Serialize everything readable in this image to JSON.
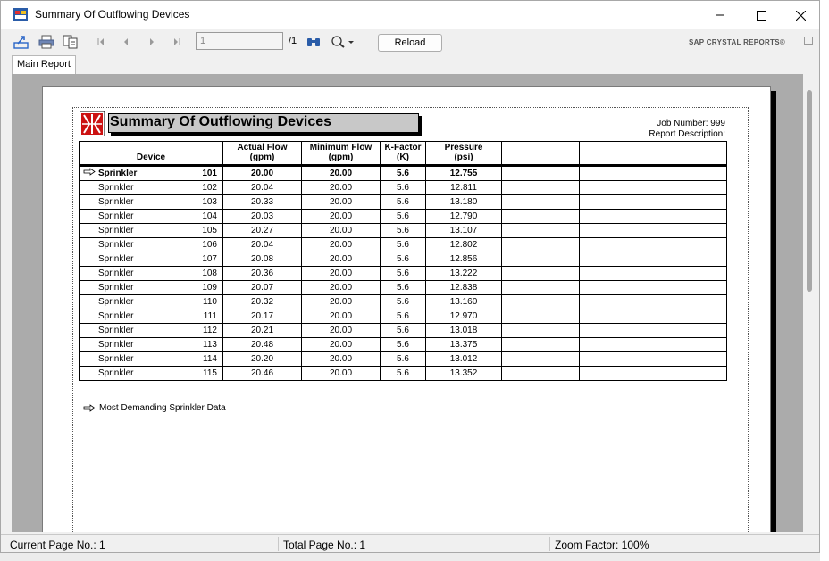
{
  "window": {
    "title": "Summary Of Outflowing Devices"
  },
  "toolbar": {
    "page_value": "1",
    "page_total": "/1",
    "reload_label": "Reload",
    "brand": "SAP CRYSTAL REPORTS®"
  },
  "tabs": [
    {
      "label": "Main Report"
    }
  ],
  "report": {
    "title": "Summary Of Outflowing Devices",
    "job_number": "Job Number: 999",
    "description": "Report Description:",
    "headers": {
      "device": "Device",
      "actual_flow": "Actual Flow",
      "actual_flow_unit": "(gpm)",
      "min_flow": "Minimum Flow",
      "min_flow_unit": "(gpm)",
      "kfactor": "K-Factor",
      "kfactor_unit": "(K)",
      "pressure": "Pressure",
      "pressure_unit": "(psi)"
    },
    "rows": [
      {
        "name": "Sprinkler",
        "num": "101",
        "actual": "20.00",
        "min": "20.00",
        "k": "5.6",
        "p": "12.755",
        "bold": true
      },
      {
        "name": "Sprinkler",
        "num": "102",
        "actual": "20.04",
        "min": "20.00",
        "k": "5.6",
        "p": "12.811"
      },
      {
        "name": "Sprinkler",
        "num": "103",
        "actual": "20.33",
        "min": "20.00",
        "k": "5.6",
        "p": "13.180"
      },
      {
        "name": "Sprinkler",
        "num": "104",
        "actual": "20.03",
        "min": "20.00",
        "k": "5.6",
        "p": "12.790"
      },
      {
        "name": "Sprinkler",
        "num": "105",
        "actual": "20.27",
        "min": "20.00",
        "k": "5.6",
        "p": "13.107"
      },
      {
        "name": "Sprinkler",
        "num": "106",
        "actual": "20.04",
        "min": "20.00",
        "k": "5.6",
        "p": "12.802"
      },
      {
        "name": "Sprinkler",
        "num": "107",
        "actual": "20.08",
        "min": "20.00",
        "k": "5.6",
        "p": "12.856"
      },
      {
        "name": "Sprinkler",
        "num": "108",
        "actual": "20.36",
        "min": "20.00",
        "k": "5.6",
        "p": "13.222"
      },
      {
        "name": "Sprinkler",
        "num": "109",
        "actual": "20.07",
        "min": "20.00",
        "k": "5.6",
        "p": "12.838"
      },
      {
        "name": "Sprinkler",
        "num": "110",
        "actual": "20.32",
        "min": "20.00",
        "k": "5.6",
        "p": "13.160"
      },
      {
        "name": "Sprinkler",
        "num": "111",
        "actual": "20.17",
        "min": "20.00",
        "k": "5.6",
        "p": "12.970"
      },
      {
        "name": "Sprinkler",
        "num": "112",
        "actual": "20.21",
        "min": "20.00",
        "k": "5.6",
        "p": "13.018"
      },
      {
        "name": "Sprinkler",
        "num": "113",
        "actual": "20.48",
        "min": "20.00",
        "k": "5.6",
        "p": "13.375"
      },
      {
        "name": "Sprinkler",
        "num": "114",
        "actual": "20.20",
        "min": "20.00",
        "k": "5.6",
        "p": "13.012"
      },
      {
        "name": "Sprinkler",
        "num": "115",
        "actual": "20.46",
        "min": "20.00",
        "k": "5.6",
        "p": "13.352"
      }
    ],
    "footer_note": "Most Demanding Sprinkler Data"
  },
  "status": {
    "current_page": "Current Page No.: 1",
    "total_page": "Total Page No.: 1",
    "zoom": "Zoom Factor: 100%"
  },
  "icons": [
    "app-icon",
    "export-icon",
    "print-icon",
    "copy-icon",
    "first-page-icon",
    "prev-page-icon",
    "next-page-icon",
    "last-page-icon",
    "find-icon",
    "zoom-icon",
    "minimize-icon",
    "maximize-icon",
    "close-icon",
    "arrow-right-icon"
  ],
  "colors": {
    "title_box": "#c8c8c8",
    "viewer_bg": "#ababab",
    "logo_red": "#cc1111"
  }
}
